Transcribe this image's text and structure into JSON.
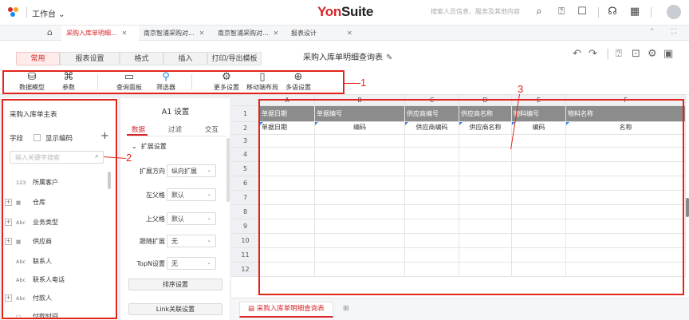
{
  "topbar": {
    "workbench_label": "工作台 ⌄",
    "brand_part1": "Yon",
    "brand_part2": "Suite",
    "search_placeholder": "搜索人员信息、服务及其他内容"
  },
  "browser_tabs": [
    {
      "label": "采购入库单明细...",
      "active": true
    },
    {
      "label": "南京智浦采购对...",
      "active": false
    },
    {
      "label": "南京智浦采购对...",
      "active": false
    },
    {
      "label": "报表设计",
      "active": false
    }
  ],
  "ribbon": {
    "tabs": [
      "常用",
      "报表设置",
      "格式",
      "插入",
      "打印/导出模板"
    ],
    "doc_title": "采购入库单明细查询表"
  },
  "toolbar": {
    "data_model": "数据模型",
    "params": "参数",
    "query_panel": "查询面板",
    "filter": "筛选器",
    "more_settings": "更多设置",
    "mobile_layout": "移动端布局",
    "multilang": "多语设置"
  },
  "callouts": {
    "one": "1",
    "two": "2",
    "three": "3"
  },
  "left_panel": {
    "title": "采购入库单主表",
    "field_label": "字段",
    "show_code": "显示编码",
    "search_placeholder": "输入关键字搜索",
    "items": [
      {
        "icon": "123",
        "label": "所属客户",
        "expandable": false
      },
      {
        "icon": "▦",
        "label": "仓库",
        "expandable": true
      },
      {
        "icon": "Abc",
        "label": "业务类型",
        "expandable": true
      },
      {
        "icon": "▦",
        "label": "供应商",
        "expandable": true
      },
      {
        "icon": "Abc",
        "label": "联系人",
        "expandable": false
      },
      {
        "icon": "Abc",
        "label": "联系人电话",
        "expandable": false
      },
      {
        "icon": "Abc",
        "label": "付款人",
        "expandable": true
      },
      {
        "icon": "▢",
        "label": "付款时间",
        "expandable": false
      }
    ]
  },
  "settings_panel": {
    "title": "A1 设置",
    "tabs": [
      "数据",
      "过滤",
      "交互"
    ],
    "group": "扩展设置",
    "rows": [
      {
        "label": "扩展方向",
        "value": "纵向扩展"
      },
      {
        "label": "左父格",
        "value": "默认"
      },
      {
        "label": "上父格",
        "value": "默认"
      },
      {
        "label": "跟随扩展",
        "value": "无"
      },
      {
        "label": "TopN设置",
        "value": "无"
      }
    ],
    "sort_button": "排序设置",
    "link_button": "Link关联设置"
  },
  "grid": {
    "columns": [
      "A",
      "B",
      "C",
      "D",
      "E",
      "F"
    ],
    "rows": [
      "1",
      "2",
      "3",
      "4",
      "5",
      "6",
      "7",
      "8",
      "9",
      "10",
      "11",
      "12"
    ],
    "header_row": [
      "单据日期",
      "单据编号",
      "供应商编号",
      "供应商名称",
      "物料编号",
      "物料名称"
    ],
    "data_row": [
      "单据日期",
      "编码",
      "供应商编码",
      "供应商名称",
      "编码",
      "名称"
    ]
  },
  "sheet_tab": "采购入库单明细查询表"
}
